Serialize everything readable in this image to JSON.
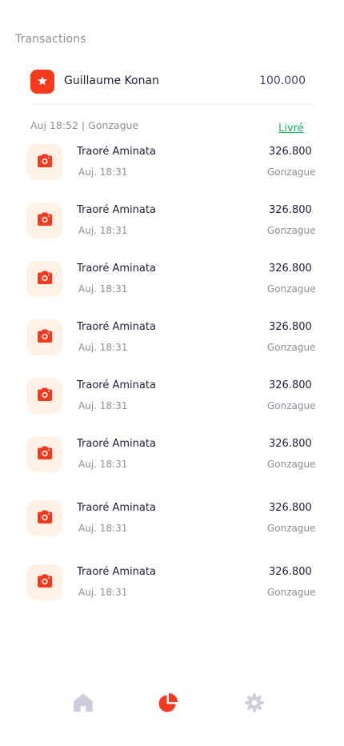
{
  "header": {
    "title": "Transactions"
  },
  "featured": {
    "name": "Guillaume Konan",
    "amount": "100.000",
    "icon": "star-icon"
  },
  "group": {
    "meta": "Auj 18:52 | Gonzague",
    "status": "Livré",
    "status_color": "#19b35b"
  },
  "rows": [
    {
      "name": "Traoré Aminata",
      "time": "Auj. 18:31",
      "amount": "326.800",
      "place": "Gonzague"
    },
    {
      "name": "Traoré Aminata",
      "time": "Auj. 18:31",
      "amount": "326.800",
      "place": "Gonzague"
    },
    {
      "name": "Traoré Aminata",
      "time": "Auj. 18:31",
      "amount": "326.800",
      "place": "Gonzague"
    },
    {
      "name": "Traoré Aminata",
      "time": "Auj. 18:31",
      "amount": "326.800",
      "place": "Gonzague"
    },
    {
      "name": "Traoré Aminata",
      "time": "Auj. 18:31",
      "amount": "326.800",
      "place": "Gonzague"
    },
    {
      "name": "Traoré Aminata",
      "time": "Auj. 18:31",
      "amount": "326.800",
      "place": "Gonzague"
    },
    {
      "name": "Traoré Aminata",
      "time": "Auj. 18:31",
      "amount": "326.800",
      "place": "Gonzague"
    },
    {
      "name": "Traoré Aminata",
      "time": "Auj. 18:31",
      "amount": "326.800",
      "place": "Gonzague"
    }
  ],
  "row_icon": "camera-icon",
  "tabbar": {
    "items": [
      {
        "icon": "home-icon",
        "active": false
      },
      {
        "icon": "pie-chart-icon",
        "active": true
      },
      {
        "icon": "gear-icon",
        "active": false
      }
    ]
  },
  "colors": {
    "accent": "#f4391e",
    "icon_tile_bg": "#fff1e5",
    "inactive_tab": "#cfcdd9"
  }
}
